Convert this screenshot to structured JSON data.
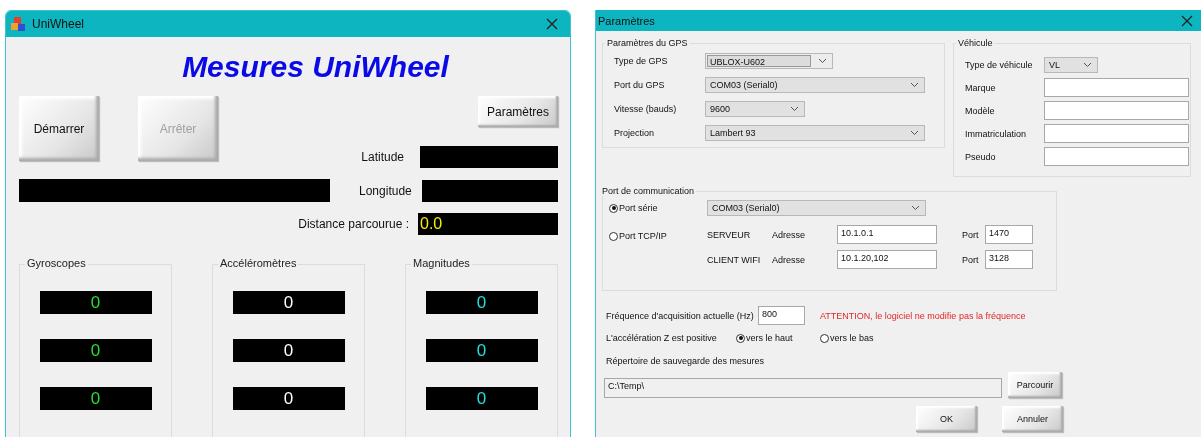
{
  "main_window": {
    "title": "UniWheel",
    "heading": "Mesures UniWheel",
    "buttons": [
      {
        "label": "Démarrer",
        "disabled": false
      },
      {
        "label": "Arrêter",
        "disabled": true
      }
    ],
    "settings_button": "Paramètres",
    "latitude": {
      "label": "Latitude"
    },
    "longitude": {
      "label": "Longitude"
    },
    "distance": {
      "label": "Distance parcourue :",
      "value": "0.0"
    },
    "groups": [
      {
        "title": "Gyroscopes",
        "color": "#22e022",
        "values": [
          "0",
          "0",
          "0"
        ]
      },
      {
        "title": "Accéléromètres",
        "color": "#ffffff",
        "values": [
          "0",
          "0",
          "0"
        ]
      },
      {
        "title": "Magnitudes",
        "color": "#22e0e0",
        "values": [
          "0",
          "0",
          "0"
        ]
      }
    ]
  },
  "settings_window": {
    "title": "Paramètres",
    "gps": {
      "title": "Paramètres du GPS",
      "rows": [
        {
          "label": "Type de GPS",
          "kind": "combo",
          "value": "UBLOX-U602"
        },
        {
          "label": "Port du GPS",
          "kind": "wide",
          "value": "COM03 (Serial0)"
        },
        {
          "label": "Vitesse (bauds)",
          "kind": "medium",
          "value": "9600"
        },
        {
          "label": "Projection",
          "kind": "wide",
          "value": "Lambert 93"
        }
      ]
    },
    "vehicle": {
      "title": "Véhicule",
      "rows": [
        {
          "label": "Type de véhicule",
          "kind": "select",
          "value": "VL"
        },
        {
          "label": "Marque",
          "kind": "text"
        },
        {
          "label": "Modèle",
          "kind": "text"
        },
        {
          "label": "Immatriculation",
          "kind": "text"
        },
        {
          "label": "Pseudo",
          "kind": "text"
        }
      ]
    },
    "communication": {
      "title": "Port de communication",
      "serial": {
        "label": "Port série",
        "selected": true,
        "value": "COM03 (Serial0)"
      },
      "tcp": {
        "label": "Port TCP/IP",
        "selected": false,
        "rows": [
          {
            "name": "SERVEUR",
            "address_label": "Adresse",
            "address": "10.1.0.1",
            "port_label": "Port",
            "port": "1470"
          },
          {
            "name": "CLIENT WIFI",
            "address_label": "Adresse",
            "address": "10.1.20,102",
            "port_label": "Port",
            "port": "3128"
          }
        ]
      }
    },
    "frequency": {
      "label": "Fréquence d'acquisition actuelle (Hz)",
      "value": "800",
      "warning": "ATTENTION, le logiciel  ne modifie pas la fréquence"
    },
    "acceleration": {
      "label": "L'accélération Z est positive",
      "options": [
        {
          "label": "vers le haut",
          "selected": true
        },
        {
          "label": "vers le bas",
          "selected": false
        }
      ]
    },
    "directory": {
      "label": "Répertoire de sauvegarde des mesures",
      "value": "C:\\Temp\\",
      "button": "Parcourir"
    },
    "buttons": [
      "OK",
      "Annuler"
    ]
  }
}
